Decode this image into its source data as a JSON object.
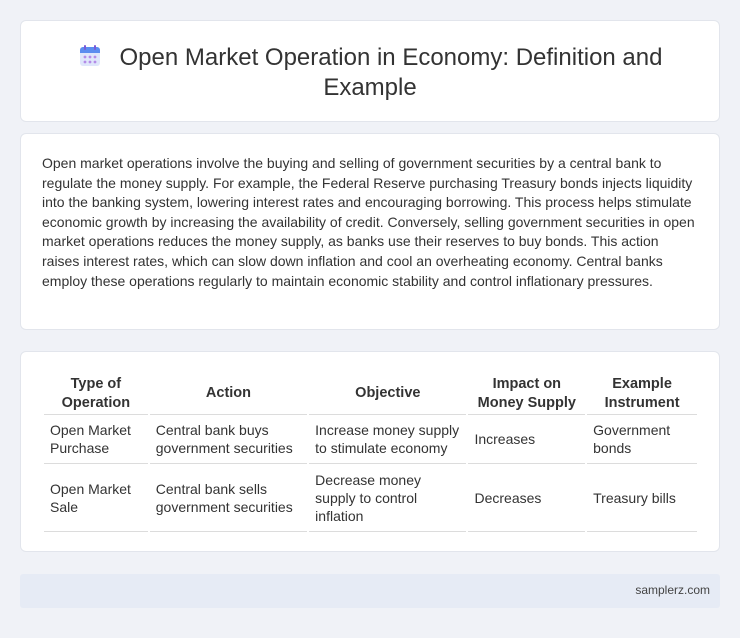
{
  "header": {
    "icon": "calendar-icon",
    "title": "Open Market Operation in Economy: Definition and Example"
  },
  "description": "Open market operations involve the buying and selling of government securities by a central bank to regulate the money supply. For example, the Federal Reserve purchasing Treasury bonds injects liquidity into the banking system, lowering interest rates and encouraging borrowing. This process helps stimulate economic growth by increasing the availability of credit. Conversely, selling government securities in open market operations reduces the money supply, as banks use their reserves to buy bonds. This action raises interest rates, which can slow down inflation and cool an overheating economy. Central banks employ these operations regularly to maintain economic stability and control inflationary pressures.",
  "table": {
    "headers": [
      "Type of Operation",
      "Action",
      "Objective",
      "Impact on Money Supply",
      "Example Instrument"
    ],
    "rows": [
      [
        "Open Market Purchase",
        "Central bank buys government securities",
        "Increase money supply to stimulate economy",
        "Increases",
        "Government bonds"
      ],
      [
        "Open Market Sale",
        "Central bank sells government securities",
        "Decrease money supply to control inflation",
        "Decreases",
        "Treasury bills"
      ]
    ]
  },
  "footer": {
    "site": "samplerz.com"
  },
  "colors": {
    "background": "#f0f2f7",
    "footer_bg": "#e6ebf5",
    "icon_accent": "#5b8def"
  }
}
